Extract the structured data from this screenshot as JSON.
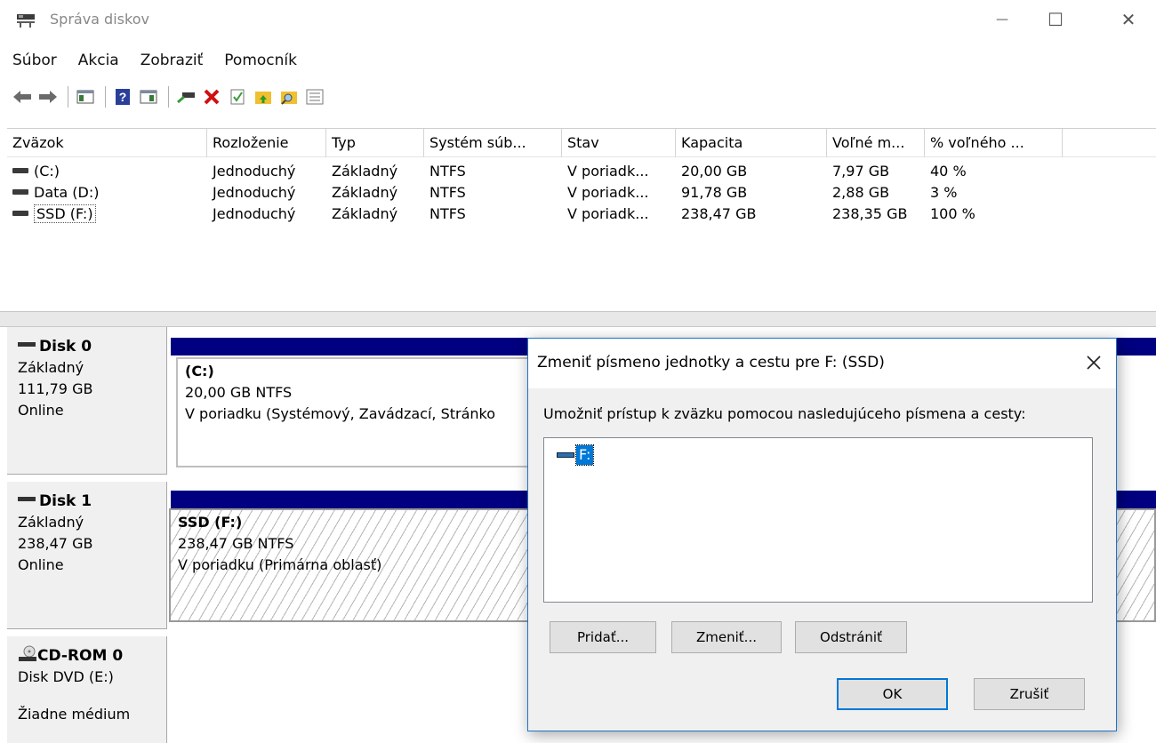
{
  "window": {
    "title": "Správa diskov",
    "minimize_glyph": "—",
    "maximize_glyph": "☐",
    "close_glyph": "✕"
  },
  "menu": {
    "items": [
      "Súbor",
      "Akcia",
      "Zobraziť",
      "Pomocník"
    ]
  },
  "toolbar": {
    "icons": [
      "back-icon",
      "forward-icon",
      "console-tree-icon",
      "help-icon",
      "show-hide-icon",
      "connect-icon",
      "delete-icon",
      "check-icon",
      "open-folder-up-icon",
      "search-folder-icon",
      "properties-list-icon"
    ]
  },
  "volumes": {
    "columns": [
      "Zväzok",
      "Rozloženie",
      "Typ",
      "Systém súb...",
      "Stav",
      "Kapacita",
      "Voľné m...",
      "% voľného ..."
    ],
    "rows": [
      {
        "volume": "(C:)",
        "layout": "Jednoduchý",
        "type": "Základný",
        "fs": "NTFS",
        "status": "V poriadk...",
        "capacity": "20,00 GB",
        "free": "7,97 GB",
        "pct": "40 %"
      },
      {
        "volume": "Data (D:)",
        "layout": "Jednoduchý",
        "type": "Základný",
        "fs": "NTFS",
        "status": "V poriadk...",
        "capacity": "91,78 GB",
        "free": "2,88 GB",
        "pct": "3 %"
      },
      {
        "volume": "SSD (F:)",
        "layout": "Jednoduchý",
        "type": "Základný",
        "fs": "NTFS",
        "status": "V poriadk...",
        "capacity": "238,47 GB",
        "free": "238,35 GB",
        "pct": "100 %"
      }
    ]
  },
  "disks": [
    {
      "name": "Disk 0",
      "type": "Základný",
      "size": "111,79 GB",
      "status": "Online",
      "partition": {
        "title": "(C:)",
        "size_fs": "20,00 GB NTFS",
        "status": "V poriadku (Systémový, Zavádzací, Stránko"
      }
    },
    {
      "name": "Disk 1",
      "type": "Základný",
      "size": "238,47 GB",
      "status": "Online",
      "partition": {
        "title": "SSD  (F:)",
        "size_fs": "238,47 GB NTFS",
        "status": "V poriadku (Primárna oblasť)"
      }
    },
    {
      "name": "CD-ROM 0",
      "type": "Disk DVD (E:)",
      "status": "Žiadne médium"
    }
  ],
  "dialog": {
    "title": "Zmeniť písmeno jednotky a cestu pre F: (SSD)",
    "prompt": "Umožniť prístup k zväzku pomocou nasledujúceho písmena a cesty:",
    "list_item": "F:",
    "add_button": "Pridať...",
    "change_button": "Zmeniť...",
    "remove_button": "Odstrániť",
    "ok_button": "OK",
    "cancel_button": "Zrušiť"
  },
  "colors": {
    "partition_bar": "#000080",
    "selection": "#0078d7",
    "dialog_border": "#1c73c9"
  }
}
